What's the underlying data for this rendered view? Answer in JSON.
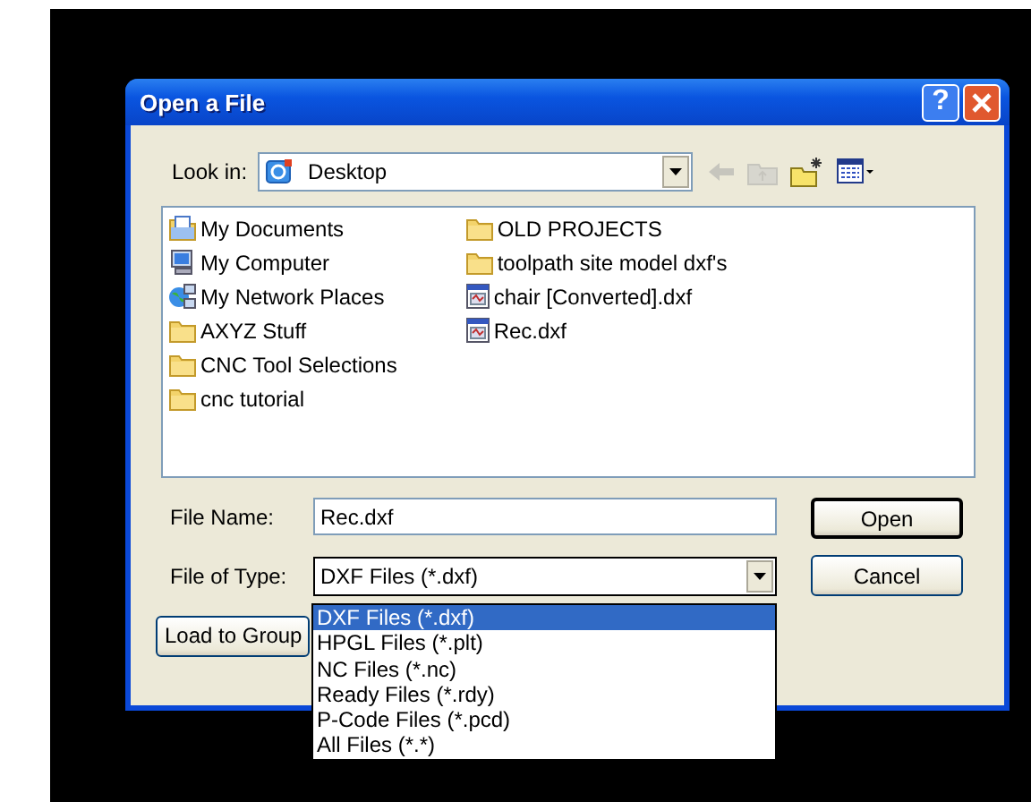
{
  "window": {
    "title": "Open a File",
    "help_button": "?"
  },
  "look_in": {
    "label": "Look in:",
    "value": "Desktop"
  },
  "toolbar": [
    {
      "kind": "back",
      "disabled": true
    },
    {
      "kind": "up",
      "disabled": true
    },
    {
      "kind": "new-folder",
      "disabled": false
    },
    {
      "kind": "views",
      "disabled": false
    }
  ],
  "files": [
    {
      "kind": "documents",
      "name": "My Documents"
    },
    {
      "kind": "computer",
      "name": "My Computer"
    },
    {
      "kind": "network",
      "name": "My Network Places"
    },
    {
      "kind": "folder",
      "name": "AXYZ Stuff"
    },
    {
      "kind": "folder",
      "name": "CNC Tool Selections"
    },
    {
      "kind": "folder",
      "name": "cnc tutorial"
    },
    {
      "kind": "folder",
      "name": "OLD PROJECTS"
    },
    {
      "kind": "folder",
      "name": "toolpath site model dxf's"
    },
    {
      "kind": "dxf",
      "name": "chair [Converted].dxf"
    },
    {
      "kind": "dxf",
      "name": "Rec.dxf"
    }
  ],
  "file_name": {
    "label": "File Name:",
    "value": "Rec.dxf"
  },
  "file_type": {
    "label": "File of Type:",
    "value": "DXF Files (*.dxf)",
    "expanded": true,
    "options": [
      {
        "label": "DXF Files (*.dxf)",
        "selected": true
      },
      {
        "label": "HPGL Files (*.plt)",
        "selected": false
      },
      {
        "label": "NC Files (*.nc)",
        "selected": false
      },
      {
        "label": "Ready Files (*.rdy)",
        "selected": false
      },
      {
        "label": "P-Code Files (*.pcd)",
        "selected": false
      },
      {
        "label": "All Files (*.*)",
        "selected": false
      }
    ]
  },
  "buttons": {
    "open": "Open",
    "cancel": "Cancel",
    "load_to_group": "Load to Group"
  }
}
